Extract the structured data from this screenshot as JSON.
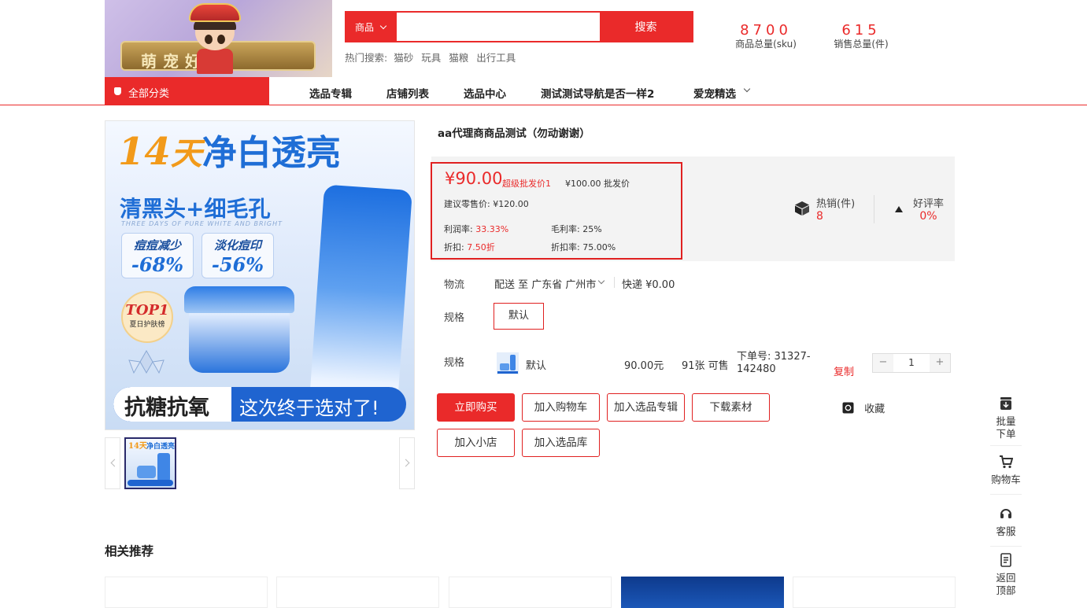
{
  "header": {
    "search": {
      "category": "商品",
      "placeholder": "",
      "button": "搜索"
    },
    "hot": {
      "label": "热门搜索:",
      "items": [
        "猫砂",
        "玩具",
        "猫粮",
        "出行工具"
      ]
    },
    "stats": [
      {
        "value": "8700",
        "caption": "商品总量(sku)"
      },
      {
        "value": "615",
        "caption": "销售总量(件)"
      }
    ]
  },
  "nav": {
    "all_categories": "全部分类",
    "items": [
      "选品专辑",
      "店铺列表",
      "选品中心",
      "测试测试导航是否一样2",
      "爱宠精选"
    ]
  },
  "gallery": {
    "main_image": {
      "line1a": "14",
      "line1b": "天",
      "line1c": "净白透亮",
      "line2": "清黑头+细毛孔",
      "line3": "THREE DAYS OF PURE WHITE AND BRIGHT",
      "card1_label": "痘痘减少",
      "card1_value": "-68%",
      "card2_label": "淡化痘印",
      "card2_value": "-56%",
      "badge_title": "TOP1",
      "badge_sub": "夏日护肤榜",
      "band_left": "抗糖抗氧",
      "band_right": "这次终于选对了!"
    }
  },
  "product": {
    "title": "aa代理商商品测试（勿动谢谢）",
    "price": "¥90.00",
    "price_tag": "超级批发价1",
    "wholesale_price": "¥100.00 批发价",
    "retail_label": "建议零售价:",
    "retail_price": "¥120.00",
    "profit_label": "利润率:",
    "profit_value": "33.33%",
    "gross_label": "毛利率:",
    "gross_value": "25%",
    "discount_label": "折扣:",
    "discount_value": "7.50折",
    "discount_rate_label": "折扣率:",
    "discount_rate_value": "75.00%",
    "hot_sales_label": "热销(件)",
    "hot_sales_value": "8",
    "rating_label": "好评率",
    "rating_value": "0%",
    "logistics_label": "物流",
    "ship_to_label": "配送 至",
    "ship_to_value": "广东省 广州市",
    "express": "快递 ¥0.00",
    "spec_label": "规格",
    "spec_default": "默认",
    "sku": {
      "label": "规格",
      "name": "默认",
      "price": "90.00元",
      "stock": "91张 可售",
      "order_no_label": "下单号: 31327-",
      "order_no_cont": "142480",
      "copy": "复制",
      "quantity": "1",
      "minus": "−",
      "plus": "+"
    },
    "buttons": {
      "buy_now": "立即购买",
      "add_cart": "加入购物车",
      "add_album": "加入选品专辑",
      "download": "下载素材",
      "favorite": "收藏",
      "add_shop": "加入小店",
      "add_library": "加入选品库"
    }
  },
  "related": {
    "title": "相关推荐"
  },
  "sidebar": {
    "bulk_line1": "批量",
    "bulk_line2": "下单",
    "cart": "购物车",
    "service": "客服",
    "top_line1": "返回",
    "top_line2": "顶部"
  }
}
